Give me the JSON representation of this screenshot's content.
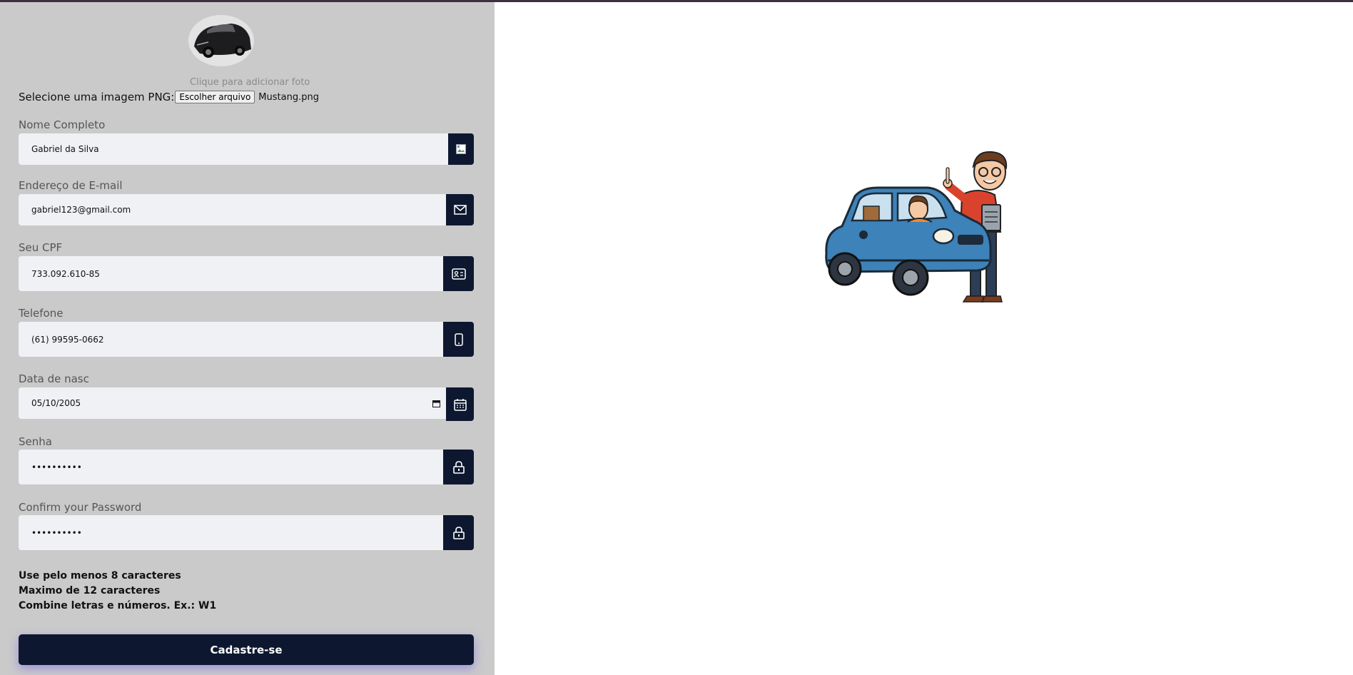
{
  "photo": {
    "hint": "Clique para adicionar foto",
    "alt": "Mustang"
  },
  "file_input": {
    "label": "Selecione uma imagem PNG:",
    "button": "Escolher arquivo",
    "filename": "Mustang.png"
  },
  "fields": {
    "name": {
      "label": "Nome Completo",
      "value": "Gabriel da Silva",
      "icon": "broken-image-icon"
    },
    "email": {
      "label": "Endereço de E-mail",
      "value": "gabriel123@gmail.com",
      "icon": "mail-icon"
    },
    "cpf": {
      "label": "Seu CPF",
      "value": "733.092.610-85",
      "icon": "id-card-icon"
    },
    "phone": {
      "label": "Telefone",
      "value": "(61) 99595-0662",
      "icon": "phone-icon"
    },
    "birth": {
      "label": "Data de nasc",
      "value": "05/10/2005",
      "icon": "calendar-icon"
    },
    "password": {
      "label": "Senha",
      "value": "••••••••••",
      "icon": "lock-icon"
    },
    "confirm": {
      "label": "Confirm your Password",
      "value": "••••••••••",
      "icon": "lock-icon"
    }
  },
  "password_rules": [
    "Use pelo menos 8 caracteres",
    "Maximo de 12 caracteres",
    "Combine letras e números. Ex.: W1"
  ],
  "submit_label": "Cadastre-se",
  "colors": {
    "panel": "#cacaca",
    "field_bg": "#f0f1f5",
    "accent": "#0d1830",
    "shadow": "#7864e6"
  }
}
